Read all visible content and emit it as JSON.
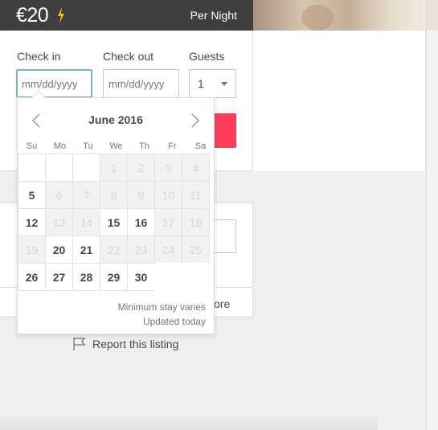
{
  "price_bar": {
    "price": "€20",
    "per_night": "Per Night",
    "accent": "#ffb400"
  },
  "booking": {
    "check_in_label": "Check in",
    "check_out_label": "Check out",
    "guests_label": "Guests",
    "check_in_placeholder": "mm/dd/yyyy",
    "check_out_placeholder": "mm/dd/yyyy",
    "guests_value": "1",
    "book_color": "#ff3c5a"
  },
  "calendar": {
    "month": "June 2016",
    "weekdays": [
      "Su",
      "Mo",
      "Tu",
      "We",
      "Th",
      "Fr",
      "Sa"
    ],
    "weeks": [
      [
        {
          "d": "",
          "s": "empty"
        },
        {
          "d": "",
          "s": "empty"
        },
        {
          "d": "",
          "s": "empty"
        },
        {
          "d": "1",
          "s": "blocked"
        },
        {
          "d": "2",
          "s": "blocked"
        },
        {
          "d": "3",
          "s": "blocked"
        },
        {
          "d": "4",
          "s": "blocked"
        }
      ],
      [
        {
          "d": "5",
          "s": "avail"
        },
        {
          "d": "6",
          "s": "blocked"
        },
        {
          "d": "7",
          "s": "blocked"
        },
        {
          "d": "8",
          "s": "blocked"
        },
        {
          "d": "9",
          "s": "blocked"
        },
        {
          "d": "10",
          "s": "blocked"
        },
        {
          "d": "11",
          "s": "blocked"
        }
      ],
      [
        {
          "d": "12",
          "s": "avail"
        },
        {
          "d": "13",
          "s": "blocked"
        },
        {
          "d": "14",
          "s": "blocked"
        },
        {
          "d": "15",
          "s": "avail"
        },
        {
          "d": "16",
          "s": "avail"
        },
        {
          "d": "17",
          "s": "blocked"
        },
        {
          "d": "18",
          "s": "blocked"
        }
      ],
      [
        {
          "d": "19",
          "s": "blocked"
        },
        {
          "d": "20",
          "s": "avail"
        },
        {
          "d": "21",
          "s": "avail"
        },
        {
          "d": "22",
          "s": "blocked"
        },
        {
          "d": "23",
          "s": "blocked"
        },
        {
          "d": "24",
          "s": "blocked"
        },
        {
          "d": "25",
          "s": "blocked"
        }
      ],
      [
        {
          "d": "26",
          "s": "avail"
        },
        {
          "d": "27",
          "s": "avail"
        },
        {
          "d": "28",
          "s": "avail"
        },
        {
          "d": "29",
          "s": "avail"
        },
        {
          "d": "30",
          "s": "avail"
        },
        {
          "d": "",
          "s": "empty"
        },
        {
          "d": "",
          "s": "empty"
        }
      ]
    ],
    "note_min_stay": "Minimum stay varies",
    "note_updated": "Updated today"
  },
  "secondary": {
    "more_text": "ore"
  },
  "report": {
    "label": "Report this listing"
  }
}
